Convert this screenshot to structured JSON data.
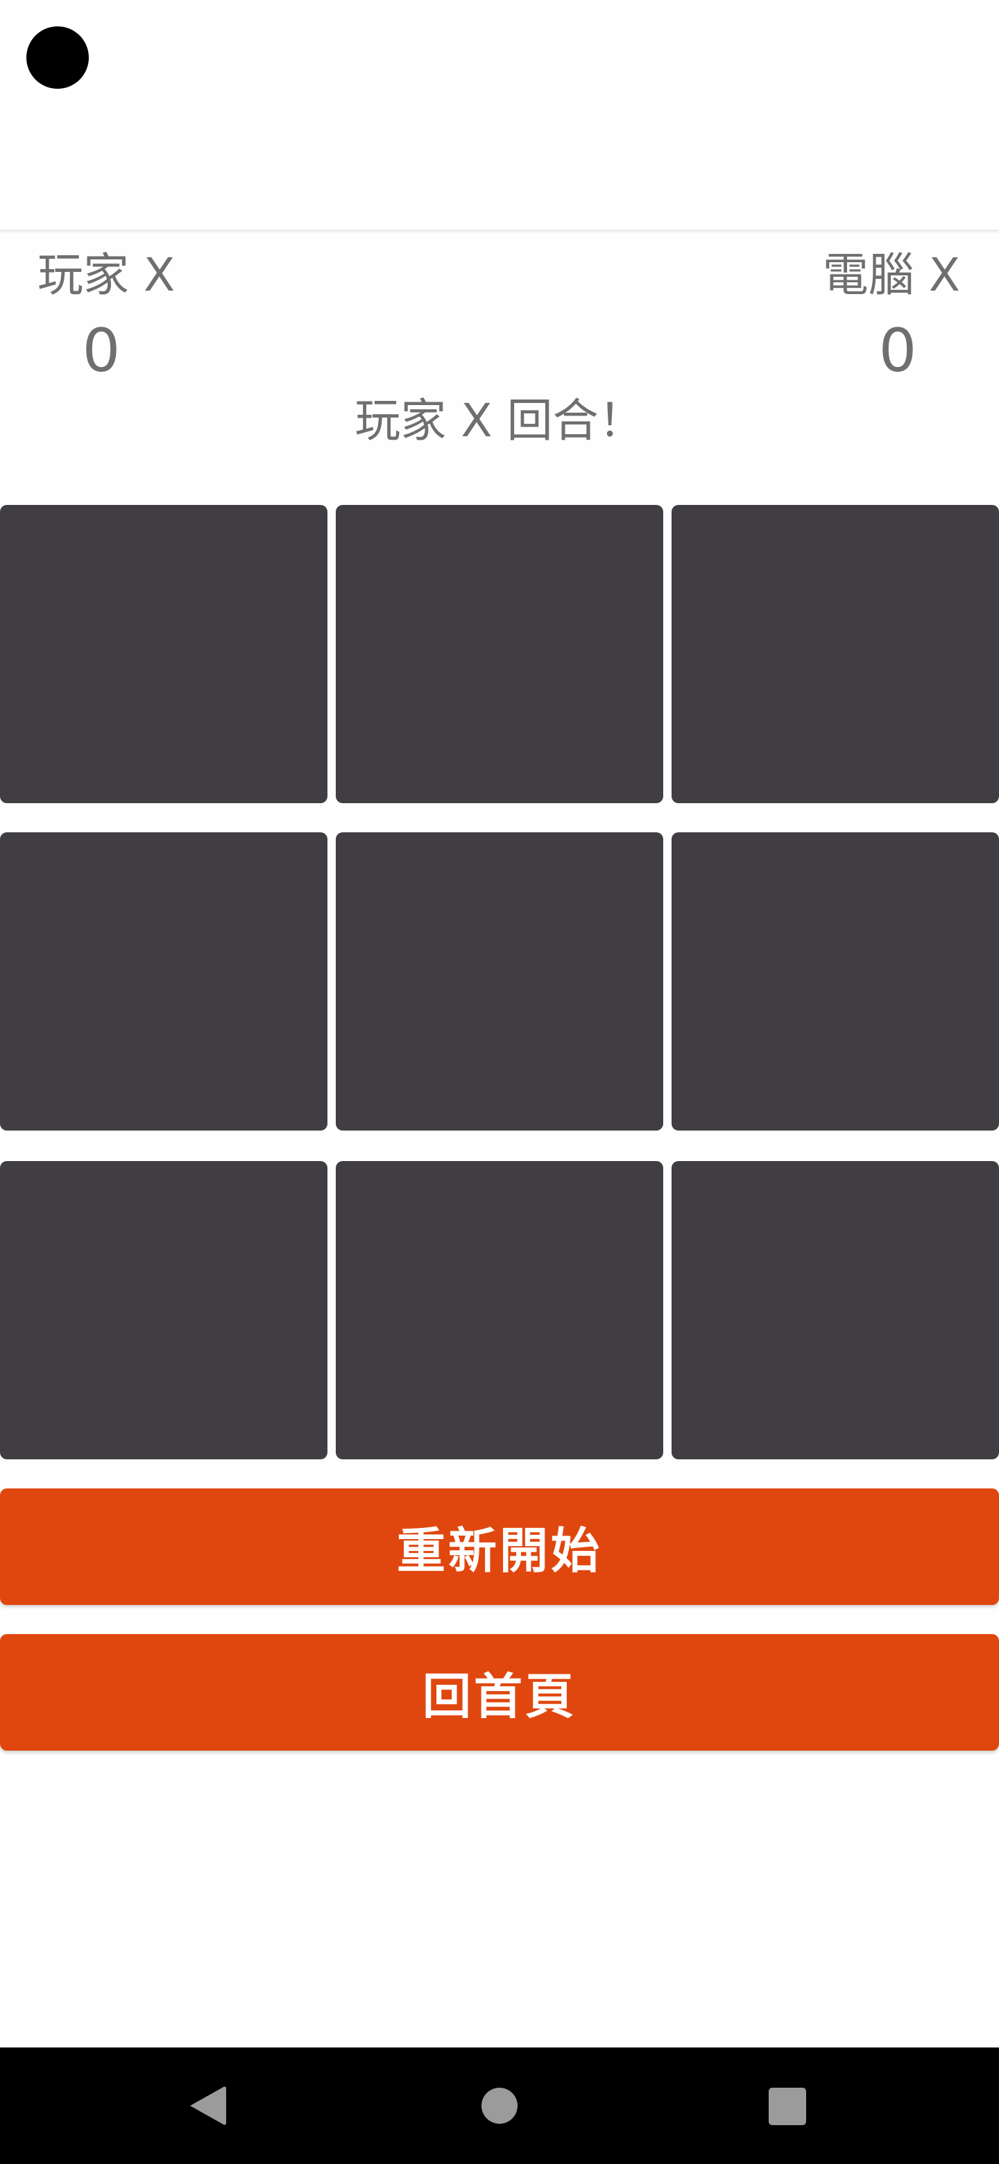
{
  "scoreboard": {
    "player_label": "玩家 X",
    "player_score": "0",
    "computer_label": "電腦 X",
    "computer_score": "0"
  },
  "status": {
    "turn_text": "玩家 X 回合！"
  },
  "board": {
    "cells": [
      "",
      "",
      "",
      "",
      "",
      "",
      "",
      "",
      ""
    ]
  },
  "buttons": {
    "restart_label": "重新開始",
    "home_label": "回首頁"
  },
  "system_nav": {
    "back_icon": "back-triangle-icon",
    "home_icon": "home-circle-icon",
    "recents_icon": "recents-square-icon"
  },
  "colors": {
    "cell": "#403e43",
    "button": "#e0470f",
    "text_muted": "#6f6f6f"
  }
}
